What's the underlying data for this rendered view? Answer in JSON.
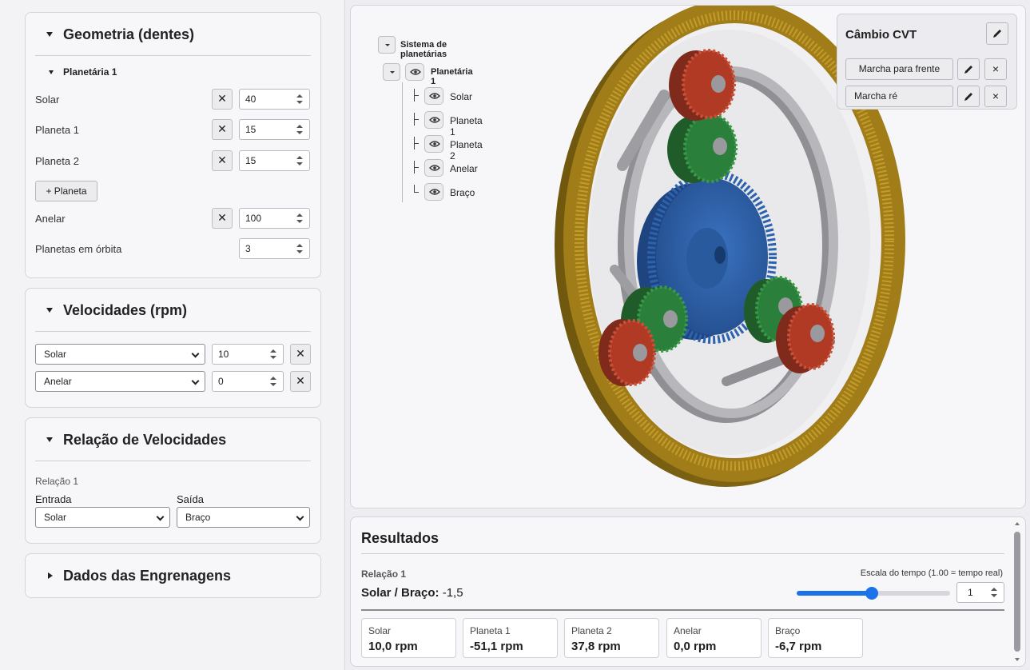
{
  "geometria": {
    "title": "Geometria (dentes)",
    "subgroup": "Planetária 1",
    "rows": [
      {
        "label": "Solar",
        "value": "40"
      },
      {
        "label": "Planeta 1",
        "value": "15"
      },
      {
        "label": "Planeta 2",
        "value": "15"
      }
    ],
    "add_planet": "+ Planeta",
    "anelar": {
      "label": "Anelar",
      "value": "100"
    },
    "orbita": {
      "label": "Planetas em órbita",
      "value": "3"
    },
    "remove_glyph": "✕"
  },
  "velocidades": {
    "title": "Velocidades (rpm)",
    "rows": [
      {
        "select": "Solar",
        "value": "10"
      },
      {
        "select": "Anelar",
        "value": "0"
      }
    ]
  },
  "relacao": {
    "title": "Relação de Velocidades",
    "sublabel": "Relação 1",
    "entrada_label": "Entrada",
    "saida_label": "Saída",
    "entrada_value": "Solar",
    "saida_value": "Braço"
  },
  "dados": {
    "title": "Dados das Engrenagens"
  },
  "tree": {
    "root": "Sistema de planetárias",
    "group": "Planetária 1",
    "items": [
      "Solar",
      "Planeta 1",
      "Planeta 2",
      "Anelar",
      "Braço"
    ]
  },
  "cvt": {
    "title": "Câmbio CVT",
    "items": [
      "Marcha para frente",
      "Marcha ré"
    ],
    "remove_glyph": "×"
  },
  "resultados": {
    "title": "Resultados",
    "relacao_label": "Relação 1",
    "ratio_label": "Solar / Braço:",
    "ratio_value": "-1,5",
    "scale_label": "Escala do tempo (1.00 = tempo real)",
    "scale_value": "1",
    "slider_fraction": 0.49,
    "stats": [
      {
        "label": "Solar",
        "value": "10,0 rpm"
      },
      {
        "label": "Planeta 1",
        "value": "-51,1 rpm"
      },
      {
        "label": "Planeta 2",
        "value": "37,8 rpm"
      },
      {
        "label": "Anelar",
        "value": "0,0 rpm"
      },
      {
        "label": "Braço",
        "value": "-6,7 rpm"
      }
    ]
  },
  "colors": {
    "ring": "#b08a1c",
    "sun": "#2a5fa8",
    "planet1": "#2a7f3a",
    "planet2": "#b03a24",
    "arm": "#a8a8ac",
    "accent": "#1a73e8"
  }
}
